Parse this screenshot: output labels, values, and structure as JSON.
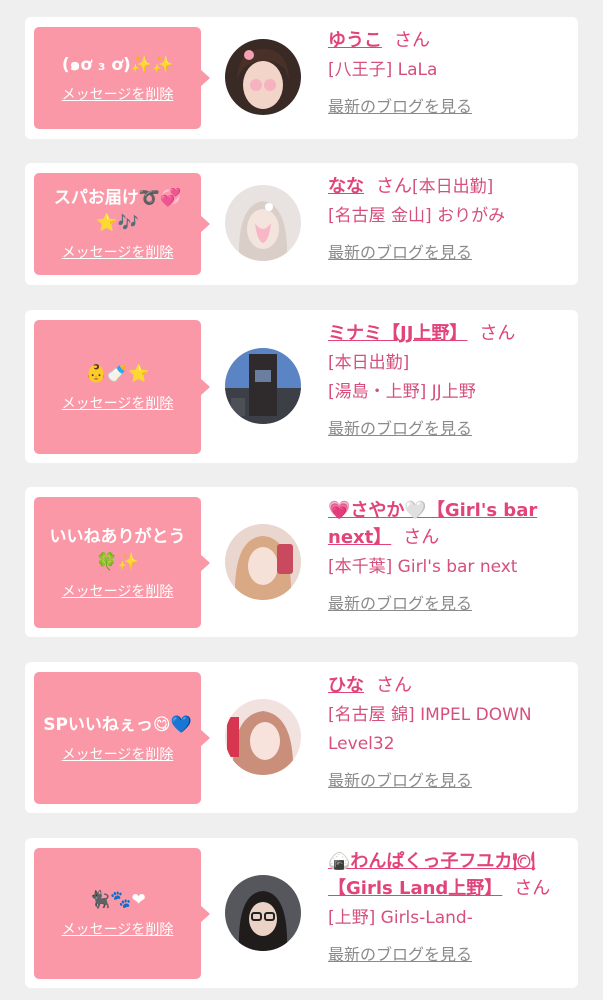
{
  "common": {
    "delete_label": "メッセージを削除",
    "blog_label": "最新のブログを見る",
    "san": "さん"
  },
  "colors": {
    "bubble": "#fa98a7",
    "name": "#e0447a",
    "area": "#d64f7e",
    "link_gray": "#8a8a8a",
    "background": "#efefef"
  },
  "entries": [
    {
      "message": "(๑ơ ₃ ơ)✨✨",
      "name": "ゆうこ",
      "after_san": "",
      "areas": [
        "[八王子] LaLa"
      ]
    },
    {
      "message": "スパお届け➰💞⭐🎶",
      "name": "なな",
      "after_san": "[本日出勤]",
      "areas": [
        "[名古屋 金山] おりがみ"
      ]
    },
    {
      "message": "👶🍼⭐",
      "name": "ミナミ【JJ上野】",
      "after_san": "",
      "areas": [
        "[本日出勤]",
        "[湯島・上野] JJ上野"
      ]
    },
    {
      "message": "いいねありがとう🍀✨",
      "name": "💗さやか🤍【Girl's bar next】",
      "after_san": "",
      "areas": [
        "[本千葉] Girl's bar next"
      ]
    },
    {
      "message": "SPいいねぇっ😋💙",
      "name": "ひな",
      "after_san": "",
      "areas": [
        "[名古屋 錦] IMPEL DOWN Level32"
      ]
    },
    {
      "message": "🐈‍⬛🐾❤",
      "name": "🍙わんぱくっ子フユカ🍽【Girls Land上野】",
      "after_san": "",
      "areas": [
        "[上野] Girls-Land-"
      ]
    }
  ]
}
